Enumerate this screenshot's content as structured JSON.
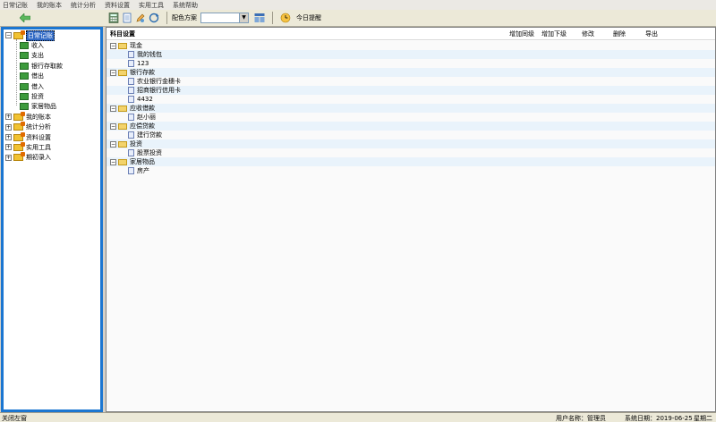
{
  "menubar": {
    "items": [
      "日常记账",
      "我的账本",
      "统计分析",
      "资料设置",
      "实用工具",
      "系统帮助"
    ]
  },
  "toolbar": {
    "scheme_label": "配色方案",
    "scheme_value": "",
    "today_reminder_label": "今日提醒"
  },
  "nav": {
    "root": {
      "label": "日常记账",
      "expanded": true
    },
    "children": [
      "收入",
      "支出",
      "银行存取款",
      "借出",
      "借入",
      "投资",
      "家居物品"
    ],
    "others": [
      "我的账本",
      "统计分析",
      "资料设置",
      "实用工具",
      "期初录入"
    ]
  },
  "content": {
    "title": "科目设置",
    "actions": {
      "add_same": "增加同级",
      "add_child": "增加下级",
      "edit": "修改",
      "delete": "删除",
      "export": "导出"
    },
    "tree": [
      {
        "label": "现金",
        "children": [
          "我的钱包",
          "123"
        ]
      },
      {
        "label": "银行存款",
        "children": [
          "农业银行金穗卡",
          "招商银行信用卡",
          "4432"
        ]
      },
      {
        "label": "应收借款",
        "children": [
          "赵小丽"
        ]
      },
      {
        "label": "应偿贷款",
        "children": [
          "建行贷款"
        ]
      },
      {
        "label": "投资",
        "children": [
          "股票投资"
        ]
      },
      {
        "label": "家居物品",
        "children": [
          "房产"
        ]
      }
    ]
  },
  "statusbar": {
    "close_left": "关闭左窗",
    "user": "用户名称：管理员",
    "date": "系统日期：2019-06-25",
    "weekday": "星期二"
  },
  "colors": {
    "nav_border": "#1b76d1",
    "stripe": "#e9f3fb",
    "selected": "#316ac5"
  }
}
